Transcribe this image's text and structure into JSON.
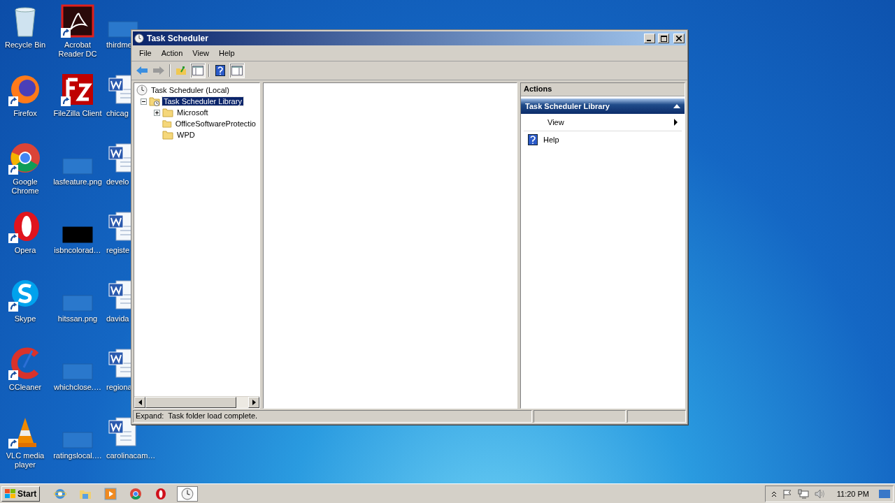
{
  "desktop": {
    "columns": [
      {
        "icons": [
          {
            "label": "Recycle Bin",
            "kind": "recycle",
            "shortcut": false
          },
          {
            "label": "Firefox",
            "kind": "firefox",
            "shortcut": true
          },
          {
            "label": "Google Chrome",
            "kind": "chrome",
            "shortcut": true
          },
          {
            "label": "Opera",
            "kind": "opera",
            "shortcut": true
          },
          {
            "label": "Skype",
            "kind": "skype",
            "shortcut": true
          },
          {
            "label": "CCleaner",
            "kind": "ccleaner",
            "shortcut": true
          },
          {
            "label": "VLC media player",
            "kind": "vlc",
            "shortcut": true
          }
        ]
      },
      {
        "icons": [
          {
            "label": "Acrobat Reader DC",
            "kind": "acrobat",
            "shortcut": true
          },
          {
            "label": "FileZilla Client",
            "kind": "filezilla",
            "shortcut": true
          },
          {
            "label": "lasfeature.png",
            "kind": "image",
            "shortcut": false
          },
          {
            "label": "isbncolorad…",
            "kind": "dark-image",
            "shortcut": false
          },
          {
            "label": "hitssan.png",
            "kind": "image",
            "shortcut": false
          },
          {
            "label": "whichclose.…",
            "kind": "image",
            "shortcut": false
          },
          {
            "label": "ratingslocal.…",
            "kind": "image",
            "shortcut": false
          }
        ]
      },
      {
        "icons": [
          {
            "label": "thirdme",
            "kind": "blank",
            "shortcut": false
          },
          {
            "label": "chicag",
            "kind": "word",
            "shortcut": false
          },
          {
            "label": "develo",
            "kind": "word",
            "shortcut": false
          },
          {
            "label": "registe",
            "kind": "word",
            "shortcut": false
          },
          {
            "label": "davida",
            "kind": "word",
            "shortcut": false
          },
          {
            "label": "regiona",
            "kind": "word",
            "shortcut": false
          },
          {
            "label": "carolinacam…",
            "kind": "word",
            "shortcut": false
          }
        ]
      }
    ]
  },
  "window": {
    "title": "Task Scheduler",
    "menu": [
      "File",
      "Action",
      "View",
      "Help"
    ],
    "toolbar": [
      {
        "kind": "back",
        "pressed": false
      },
      {
        "kind": "forward",
        "pressed": false
      },
      {
        "kind": "up",
        "pressed": false
      },
      {
        "kind": "tree",
        "pressed": true
      },
      {
        "kind": "help",
        "pressed": false
      },
      {
        "kind": "actions",
        "pressed": true
      }
    ],
    "tree": [
      {
        "label": "Task Scheduler (Local)",
        "kind": "root",
        "selected": false,
        "children": [
          {
            "label": "Task Scheduler Library",
            "kind": "library",
            "expanded": true,
            "selected": true,
            "children": [
              {
                "label": "Microsoft",
                "kind": "folder",
                "expanded": false,
                "selected": false
              },
              {
                "label": "OfficeSoftwareProtectio",
                "kind": "folder",
                "selected": false
              },
              {
                "label": "WPD",
                "kind": "folder",
                "selected": false
              }
            ]
          }
        ]
      }
    ],
    "actions": {
      "title": "Actions",
      "sections": [
        {
          "title": "Task Scheduler Library",
          "expanded": true,
          "items": [
            {
              "label": "View",
              "kind": "submenu"
            },
            {
              "label": "Help",
              "kind": "help"
            }
          ]
        }
      ]
    },
    "status_bar": {
      "text": "Expand:  Task folder load complete."
    }
  },
  "taskbar": {
    "start": "Start",
    "apps": [
      {
        "kind": "ie",
        "selected": false
      },
      {
        "kind": "explorer",
        "selected": false
      },
      {
        "kind": "media",
        "selected": false
      },
      {
        "kind": "chrome",
        "selected": false
      },
      {
        "kind": "opera",
        "selected": false
      },
      {
        "kind": "clock",
        "selected": true
      }
    ],
    "time": "11:20 PM"
  }
}
